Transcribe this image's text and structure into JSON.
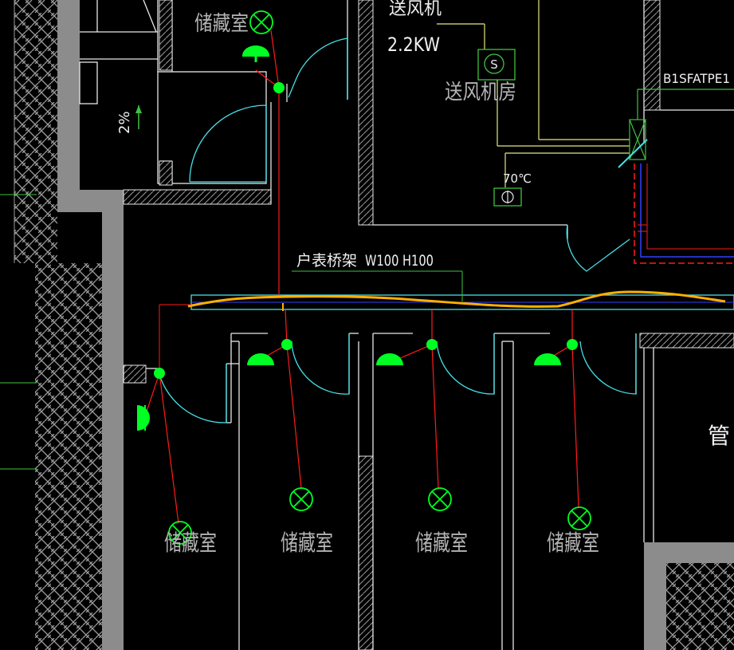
{
  "labels": {
    "room_storage_top": "储藏室",
    "fan_name": "送风机",
    "fan_power": "2.2KW",
    "fan_room": "送风机房",
    "panel_code": "B1SFATPE1",
    "fire_damper_temp": "70℃",
    "cable_tray": "户表桥架",
    "cable_tray_size": "W100 H100",
    "slope": "2%",
    "fan_symbol": "S",
    "room_storage_1": "储藏室",
    "room_storage_2": "储藏室",
    "room_storage_3": "储藏室",
    "room_storage_4": "储藏室",
    "pipe_shaft_partial": "管"
  },
  "colors": {
    "background": "#000000",
    "wall_gray": "#8c8c8c",
    "wall_white": "#e8e8e8",
    "door_cyan": "#46e0e6",
    "lamp_green": "#00ff22",
    "wire_red": "#ff1a1a",
    "text_gray": "#b4b4b4",
    "text_white": "#f0f0f0",
    "tray_orange": "#ffb000",
    "leader_green": "#3ec23e",
    "yellow_line": "#e6e682",
    "dashed_red": "#ff1a1a",
    "blue_line": "#3040ff"
  }
}
